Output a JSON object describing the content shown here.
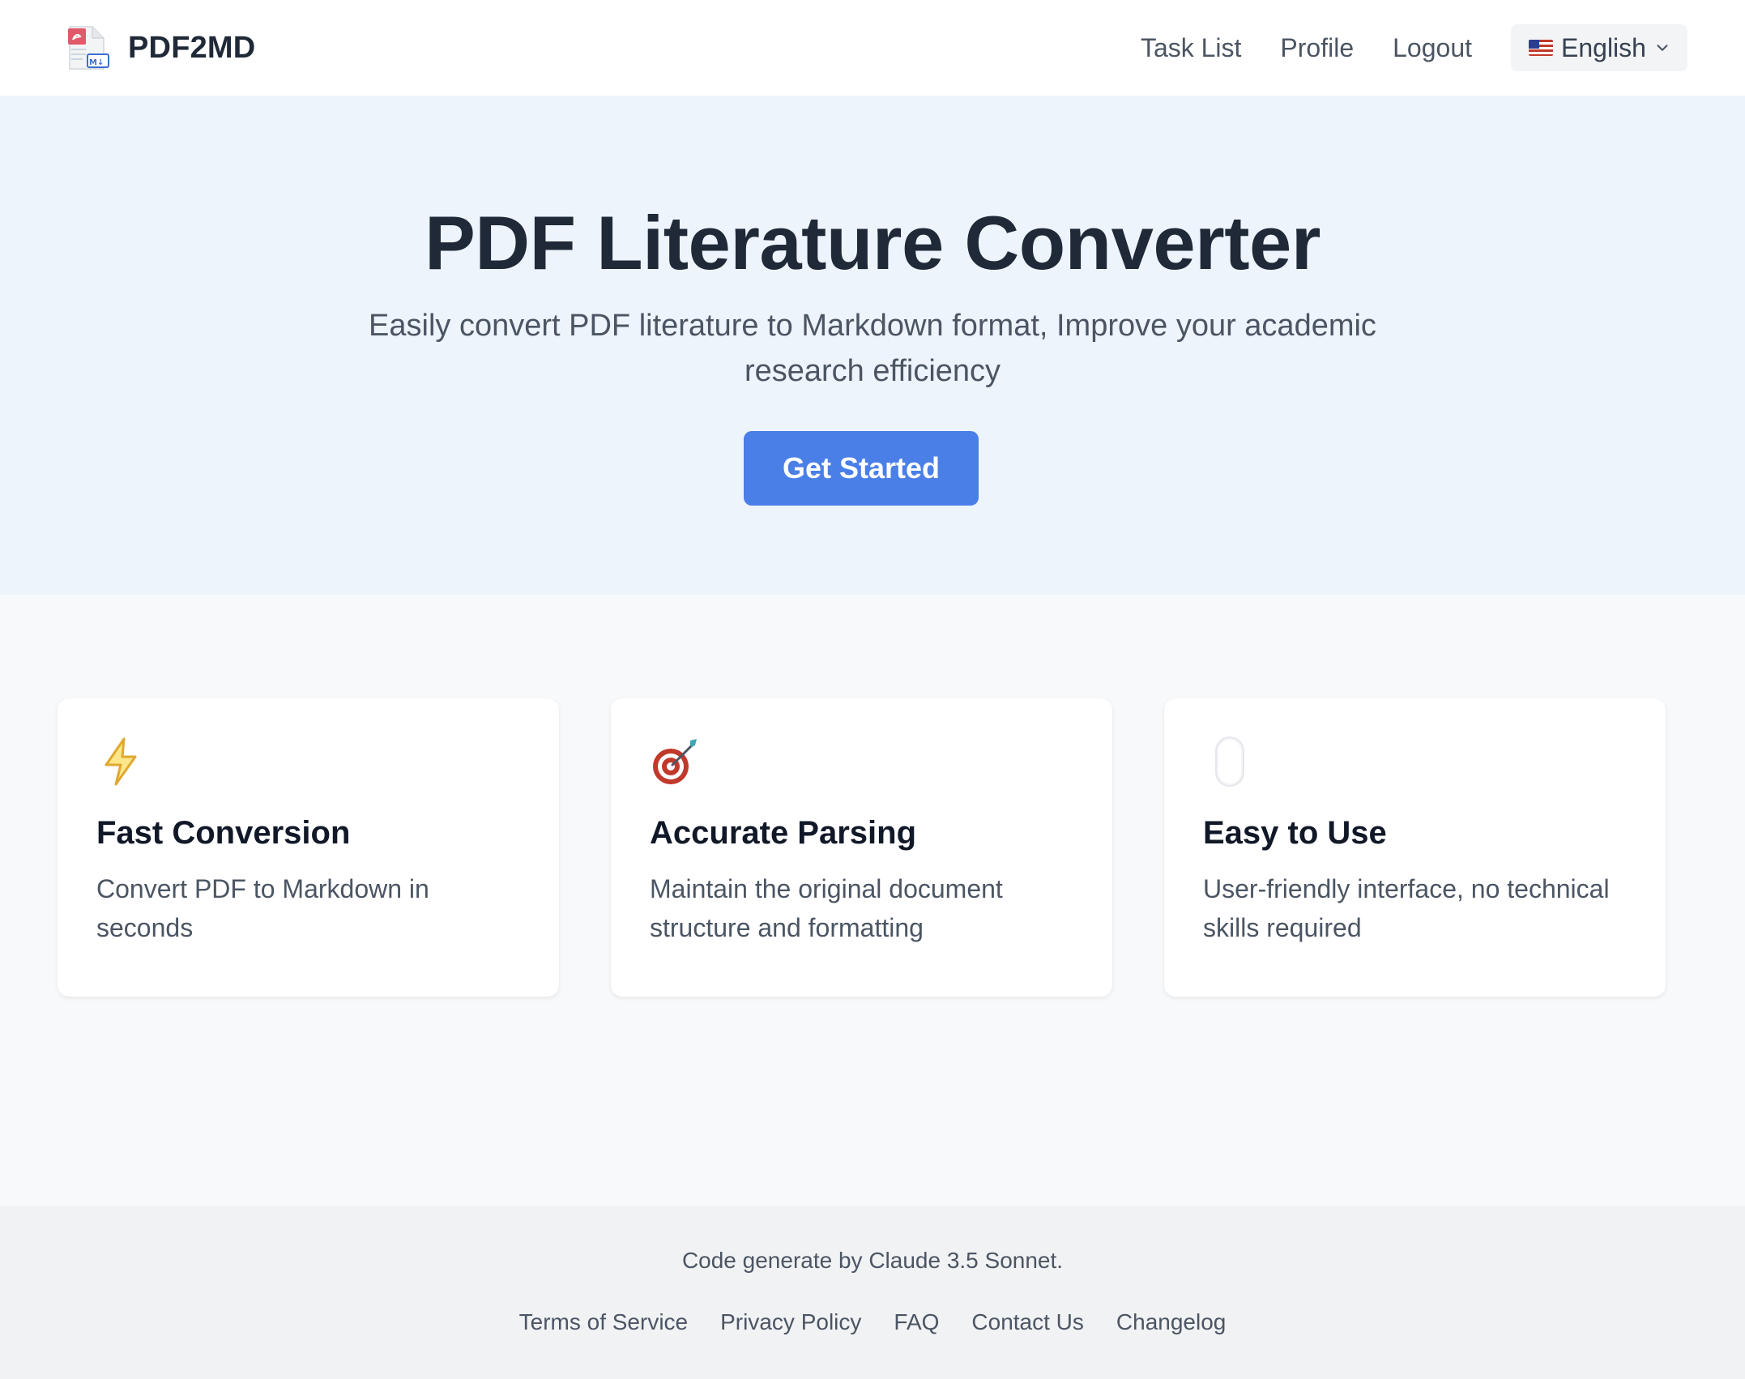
{
  "header": {
    "brand": "PDF2MD",
    "nav": {
      "task_list": "Task List",
      "profile": "Profile",
      "logout": "Logout"
    },
    "language": {
      "selected": "English",
      "flag_icon": "us-flag-icon"
    }
  },
  "hero": {
    "title": "PDF Literature Converter",
    "subtitle": "Easily convert PDF literature to Markdown format, Improve your academic research efficiency",
    "cta_label": "Get Started"
  },
  "features": [
    {
      "icon": "lightning-icon",
      "title": "Fast Conversion",
      "description": "Convert PDF to Markdown in seconds"
    },
    {
      "icon": "target-icon",
      "title": "Accurate Parsing",
      "description": "Maintain the original document structure and formatting"
    },
    {
      "icon": "mouse-icon",
      "title": "Easy to Use",
      "description": "User-friendly interface, no technical skills required"
    }
  ],
  "footer": {
    "credit": "Code generate by Claude 3.5 Sonnet.",
    "links": [
      "Terms of Service",
      "Privacy Policy",
      "FAQ",
      "Contact Us",
      "Changelog"
    ]
  },
  "colors": {
    "accent": "#4a7fe8",
    "hero_bg": "#edf4fb",
    "page_bg": "#f7f9fb",
    "footer_bg": "#f1f2f4"
  }
}
